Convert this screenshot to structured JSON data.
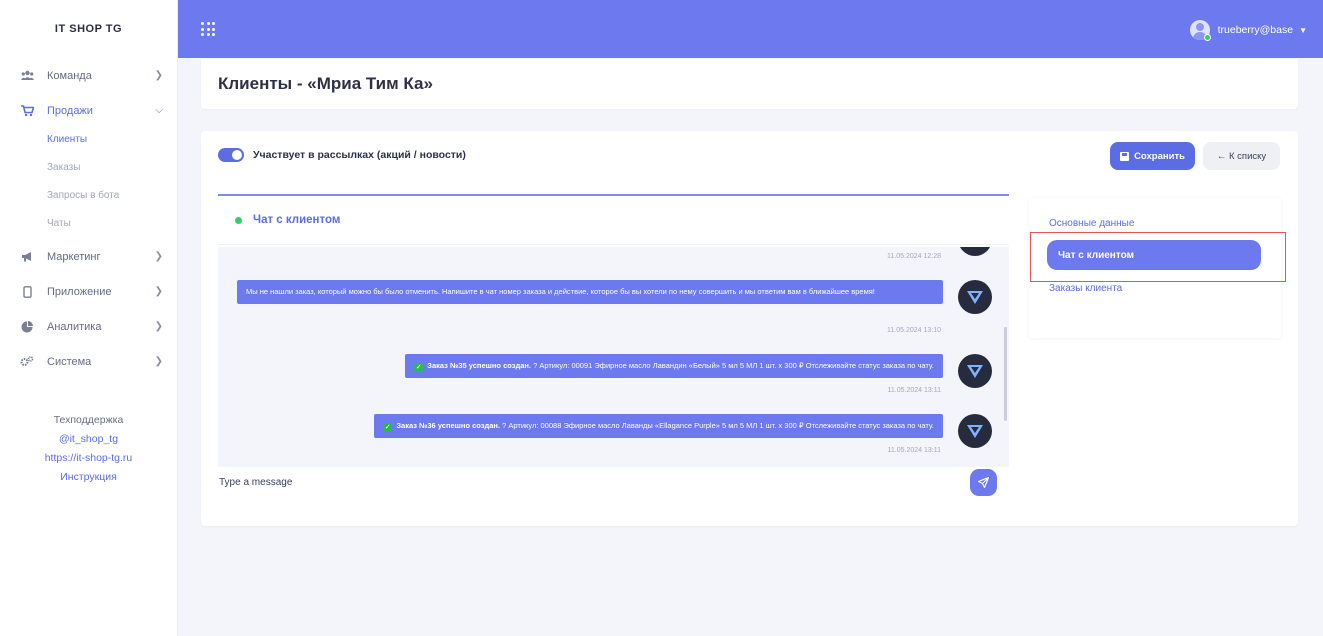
{
  "brand": "IT SHOP TG",
  "sidebar": {
    "items": [
      {
        "label": "Команда",
        "icon": "users-icon"
      },
      {
        "label": "Продажи",
        "icon": "cart-icon"
      },
      {
        "label": "Маркетинг",
        "icon": "megaphone-icon"
      },
      {
        "label": "Приложение",
        "icon": "mobile-icon"
      },
      {
        "label": "Аналитика",
        "icon": "pie-chart-icon"
      },
      {
        "label": "Система",
        "icon": "gears-icon"
      }
    ],
    "sales_sub": [
      "Клиенты",
      "Заказы",
      "Запросы в бота",
      "Чаты"
    ],
    "support": {
      "title": "Техподдержка",
      "telegram": "@it_shop_tg",
      "site": "https://it-shop-tg.ru",
      "manual": "Инструкция"
    }
  },
  "topbar": {
    "user": "trueberry@base"
  },
  "page": {
    "title": "Клиенты - «Мриа Тим Ка»"
  },
  "form": {
    "newsletter_label": "Участвует в рассылках (акций / новости)",
    "newsletter_on": true,
    "save_label": "Сохранить",
    "back_label": "← К списку"
  },
  "chat": {
    "title": "Чат с клиентом",
    "placeholder": "Type a message",
    "messages": [
      {
        "time": "11.05.2024 12:28"
      },
      {
        "text": "Мы не нашли заказ, который можно бы было отменить. Напишите в чат номер заказа и действие, которое бы вы хотели по нему совершить и мы ответим вам в ближайшее время!",
        "time": "11.05.2024 13:10"
      },
      {
        "bold": "Заказ №35 успешно создан.",
        "text": " ? Артикул: 00091 Эфирное масло Лавандин «Белый» 5 мл 5 МЛ 1 шт. x 300 ₽ Отслеживайте статус заказа по чату.",
        "time": "11.05.2024 13:11"
      },
      {
        "bold": "Заказ №36 успешно создан.",
        "text": " ? Артикул: 00088 Эфирное масло Лаванды «Ellagance Purple» 5 мл 5 МЛ 1 шт. x 300 ₽ Отслеживайте статус заказа по чату.",
        "time": "11.05.2024 13:11"
      }
    ]
  },
  "tabs": [
    "Основные данные",
    "Чат с клиентом",
    "Заказы клиента"
  ],
  "colors": {
    "accent": "#6d79ef",
    "active_text": "#5c6ce5",
    "online": "#2fcf6b",
    "highlight": "#e25555"
  }
}
